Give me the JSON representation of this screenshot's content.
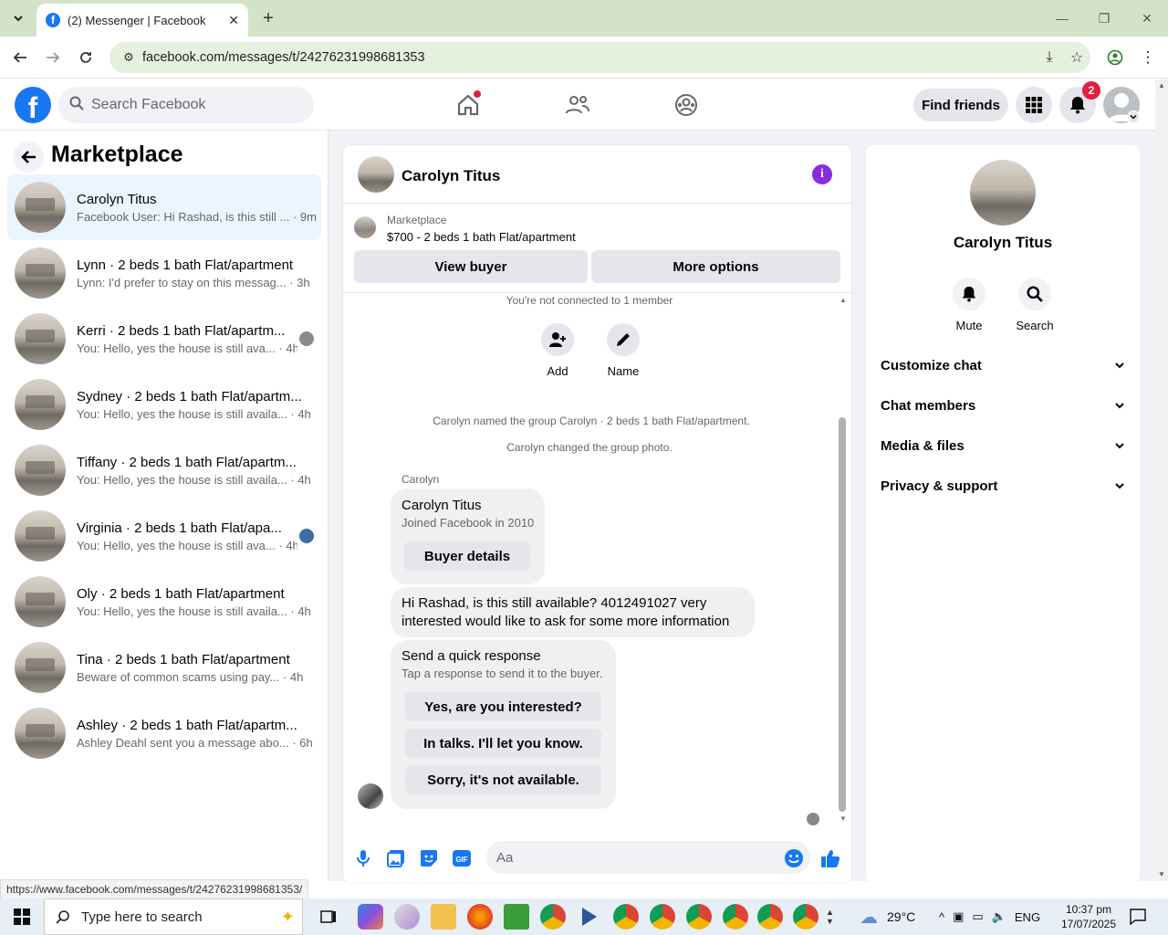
{
  "browser": {
    "tab_title": "(2) Messenger | Facebook",
    "url": "facebook.com/messages/t/24276231998681353",
    "status_url": "https://www.facebook.com/messages/t/24276231998681353/"
  },
  "fb": {
    "logo_letter": "f",
    "search_placeholder": "Search Facebook",
    "find_friends": "Find friends",
    "notif_count": "2"
  },
  "left": {
    "title": "Marketplace",
    "conversations": [
      {
        "name": "Carolyn Titus",
        "preview": "Facebook User: Hi Rashad, is this still ...",
        "time": "· 9m"
      },
      {
        "name": "Lynn · 2 beds 1 bath Flat/apartment",
        "preview": "Lynn: I'd prefer to stay on this messag...",
        "time": "· 3h"
      },
      {
        "name": "Kerri · 2 beds 1 bath Flat/apartm...",
        "preview": "You: Hello, yes the house is still ava...",
        "time": "· 4h"
      },
      {
        "name": "Sydney · 2 beds 1 bath Flat/apartm...",
        "preview": "You: Hello, yes the house is still availa...",
        "time": "· 4h"
      },
      {
        "name": "Tiffany · 2 beds 1 bath Flat/apartm...",
        "preview": "You: Hello, yes the house is still availa...",
        "time": "· 4h"
      },
      {
        "name": "Virginia · 2 beds 1 bath Flat/apa...",
        "preview": "You: Hello, yes the house is still ava...",
        "time": "· 4h"
      },
      {
        "name": "Oly · 2 beds 1 bath Flat/apartment",
        "preview": "You: Hello, yes the house is still availa...",
        "time": "· 4h"
      },
      {
        "name": "Tina · 2 beds 1 bath Flat/apartment",
        "preview": "Beware of common scams using pay...",
        "time": "· 4h"
      },
      {
        "name": "Ashley · 2 beds 1 bath Flat/apartm...",
        "preview": "Ashley Deahl sent you a message abo...",
        "time": "· 6h"
      }
    ]
  },
  "chat": {
    "name": "Carolyn Titus",
    "marketplace_label": "Marketplace",
    "listing": "$700 - 2 beds 1 bath Flat/apartment",
    "view_buyer": "View buyer",
    "more_options": "More options",
    "not_connected": "You're not connected to 1 member",
    "add_label": "Add",
    "name_label": "Name",
    "event1": "Carolyn named the group Carolyn · 2 beds 1 bath Flat/apartment.",
    "event2": "Carolyn changed the group photo.",
    "sender": "Carolyn",
    "card_name": "Carolyn Titus",
    "card_joined": "Joined Facebook in 2010",
    "buyer_details": "Buyer details",
    "message_line1": "Hi Rashad, is this still available? 4012491027 very",
    "message_line2": "interested would like to ask for some more information",
    "quick_title": "Send a quick response",
    "quick_sub": "Tap a response to send it to the buyer.",
    "quick_replies": [
      "Yes, are you interested?",
      "In talks. I'll let you know.",
      "Sorry, it's not available."
    ],
    "composer_placeholder": "Aa"
  },
  "right": {
    "name": "Carolyn Titus",
    "mute": "Mute",
    "search": "Search",
    "sections": [
      "Customize chat",
      "Chat members",
      "Media & files",
      "Privacy & support"
    ]
  },
  "taskbar": {
    "search_text": "Type here to search",
    "weather": "29°C",
    "lang": "ENG",
    "time": "10:37 pm",
    "date": "17/07/2025"
  },
  "colors": {
    "fb_blue": "#1877f2",
    "badge_red": "#e41e3f",
    "info_purple": "#8a2be2",
    "active_conv": "#ebf5ff"
  }
}
